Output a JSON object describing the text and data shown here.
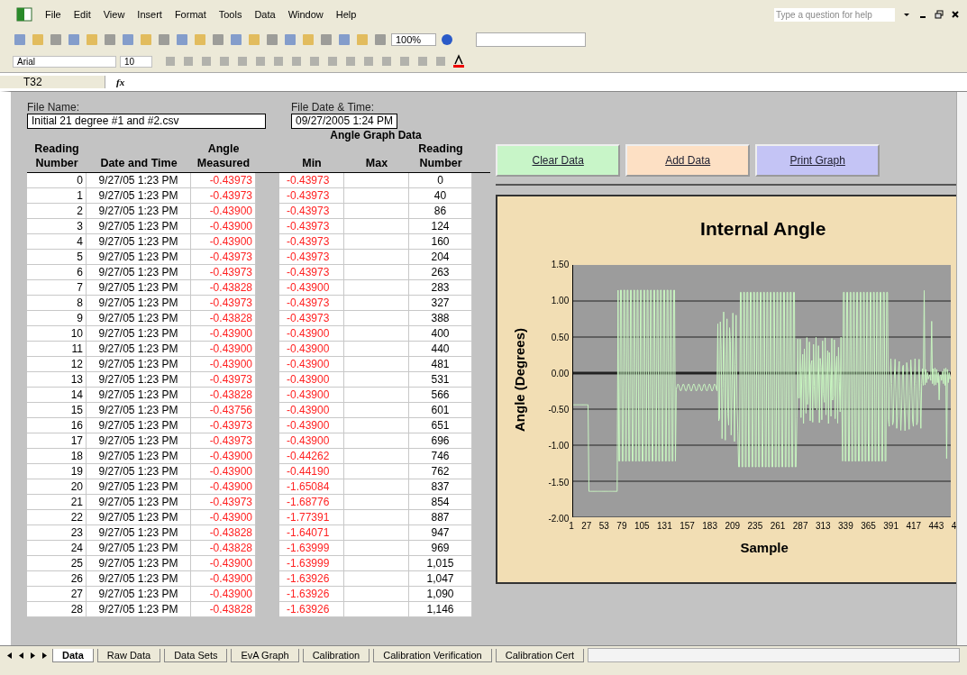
{
  "menu": [
    "File",
    "Edit",
    "View",
    "Insert",
    "Format",
    "Tools",
    "Data",
    "Window",
    "Help"
  ],
  "help_box": {
    "placeholder": "Type a question for help"
  },
  "toolbar": {
    "zoom": "100%"
  },
  "format_bar": {
    "font": "Arial",
    "size": "10"
  },
  "formula_bar": {
    "cell": "T32",
    "fx": "fx"
  },
  "file_name": {
    "label": "File Name:",
    "value": "Initial 21 degree #1 and #2.csv"
  },
  "file_date": {
    "label": "File Date & Time:",
    "value": "09/27/2005 1:24 PM"
  },
  "graph_data_title": "Angle Graph Data",
  "columns": [
    [
      "Reading",
      "Number"
    ],
    [
      "Date and Time"
    ],
    [
      "Angle",
      "Measured"
    ],
    [
      "Min"
    ],
    [
      "Max"
    ],
    [
      "Reading",
      "Number"
    ]
  ],
  "rows": [
    {
      "n": "0",
      "time": "9/27/05 1:23 PM",
      "angle": "-0.43973",
      "min": "-0.43973",
      "reading": "0"
    },
    {
      "n": "1",
      "time": "9/27/05 1:23 PM",
      "angle": "-0.43973",
      "min": "-0.43973",
      "reading": "40"
    },
    {
      "n": "2",
      "time": "9/27/05 1:23 PM",
      "angle": "-0.43900",
      "min": "-0.43973",
      "reading": "86"
    },
    {
      "n": "3",
      "time": "9/27/05 1:23 PM",
      "angle": "-0.43900",
      "min": "-0.43973",
      "reading": "124"
    },
    {
      "n": "4",
      "time": "9/27/05 1:23 PM",
      "angle": "-0.43900",
      "min": "-0.43973",
      "reading": "160"
    },
    {
      "n": "5",
      "time": "9/27/05 1:23 PM",
      "angle": "-0.43973",
      "min": "-0.43973",
      "reading": "204"
    },
    {
      "n": "6",
      "time": "9/27/05 1:23 PM",
      "angle": "-0.43973",
      "min": "-0.43973",
      "reading": "263"
    },
    {
      "n": "7",
      "time": "9/27/05 1:23 PM",
      "angle": "-0.43828",
      "min": "-0.43900",
      "reading": "283"
    },
    {
      "n": "8",
      "time": "9/27/05 1:23 PM",
      "angle": "-0.43973",
      "min": "-0.43973",
      "reading": "327"
    },
    {
      "n": "9",
      "time": "9/27/05 1:23 PM",
      "angle": "-0.43828",
      "min": "-0.43973",
      "reading": "388"
    },
    {
      "n": "10",
      "time": "9/27/05 1:23 PM",
      "angle": "-0.43900",
      "min": "-0.43900",
      "reading": "400"
    },
    {
      "n": "11",
      "time": "9/27/05 1:23 PM",
      "angle": "-0.43900",
      "min": "-0.43900",
      "reading": "440"
    },
    {
      "n": "12",
      "time": "9/27/05 1:23 PM",
      "angle": "-0.43900",
      "min": "-0.43900",
      "reading": "481"
    },
    {
      "n": "13",
      "time": "9/27/05 1:23 PM",
      "angle": "-0.43973",
      "min": "-0.43900",
      "reading": "531"
    },
    {
      "n": "14",
      "time": "9/27/05 1:23 PM",
      "angle": "-0.43828",
      "min": "-0.43900",
      "reading": "566"
    },
    {
      "n": "15",
      "time": "9/27/05 1:23 PM",
      "angle": "-0.43756",
      "min": "-0.43900",
      "reading": "601"
    },
    {
      "n": "16",
      "time": "9/27/05 1:23 PM",
      "angle": "-0.43973",
      "min": "-0.43900",
      "reading": "651"
    },
    {
      "n": "17",
      "time": "9/27/05 1:23 PM",
      "angle": "-0.43973",
      "min": "-0.43900",
      "reading": "696"
    },
    {
      "n": "18",
      "time": "9/27/05 1:23 PM",
      "angle": "-0.43900",
      "min": "-0.44262",
      "reading": "746"
    },
    {
      "n": "19",
      "time": "9/27/05 1:23 PM",
      "angle": "-0.43900",
      "min": "-0.44190",
      "reading": "762"
    },
    {
      "n": "20",
      "time": "9/27/05 1:23 PM",
      "angle": "-0.43900",
      "min": "-1.65084",
      "reading": "837"
    },
    {
      "n": "21",
      "time": "9/27/05 1:23 PM",
      "angle": "-0.43973",
      "min": "-1.68776",
      "reading": "854"
    },
    {
      "n": "22",
      "time": "9/27/05 1:23 PM",
      "angle": "-0.43900",
      "min": "-1.77391",
      "reading": "887"
    },
    {
      "n": "23",
      "time": "9/27/05 1:23 PM",
      "angle": "-0.43828",
      "min": "-1.64071",
      "reading": "947"
    },
    {
      "n": "24",
      "time": "9/27/05 1:23 PM",
      "angle": "-0.43828",
      "min": "-1.63999",
      "reading": "969"
    },
    {
      "n": "25",
      "time": "9/27/05 1:23 PM",
      "angle": "-0.43900",
      "min": "-1.63999",
      "reading": "1,015"
    },
    {
      "n": "26",
      "time": "9/27/05 1:23 PM",
      "angle": "-0.43900",
      "min": "-1.63926",
      "reading": "1,047"
    },
    {
      "n": "27",
      "time": "9/27/05 1:23 PM",
      "angle": "-0.43900",
      "min": "-1.63926",
      "reading": "1,090"
    },
    {
      "n": "28",
      "time": "9/27/05 1:23 PM",
      "angle": "-0.43828",
      "min": "-1.63926",
      "reading": "1,146"
    }
  ],
  "buttons": [
    {
      "label": "Clear Data",
      "color": "#c8f5c8"
    },
    {
      "label": "Add Data",
      "color": "#fde0c4"
    },
    {
      "label": "Print Graph",
      "color": "#c4c4f5"
    }
  ],
  "chart": {
    "title": "Internal Angle",
    "ylabel": "Angle (Degrees)",
    "xlabel": "Sample",
    "yticks": [
      "1.50",
      "1.00",
      "0.50",
      "0.00",
      "-0.50",
      "-1.00",
      "-1.50",
      "-2.00"
    ],
    "xticks": [
      "1",
      "27",
      "53",
      "79",
      "105",
      "131",
      "157",
      "183",
      "209",
      "235",
      "261",
      "287",
      "313",
      "339",
      "365",
      "391",
      "417",
      "443",
      "4"
    ]
  },
  "sheet_tabs": [
    {
      "label": "Data",
      "selected": true
    },
    {
      "label": "Raw Data",
      "selected": false
    },
    {
      "label": "Data Sets",
      "selected": false
    },
    {
      "label": "EvA Graph",
      "selected": false
    },
    {
      "label": "Calibration",
      "selected": false
    },
    {
      "label": "Calibration Verification",
      "selected": false
    },
    {
      "label": "Calibration Cert",
      "selected": false
    }
  ]
}
